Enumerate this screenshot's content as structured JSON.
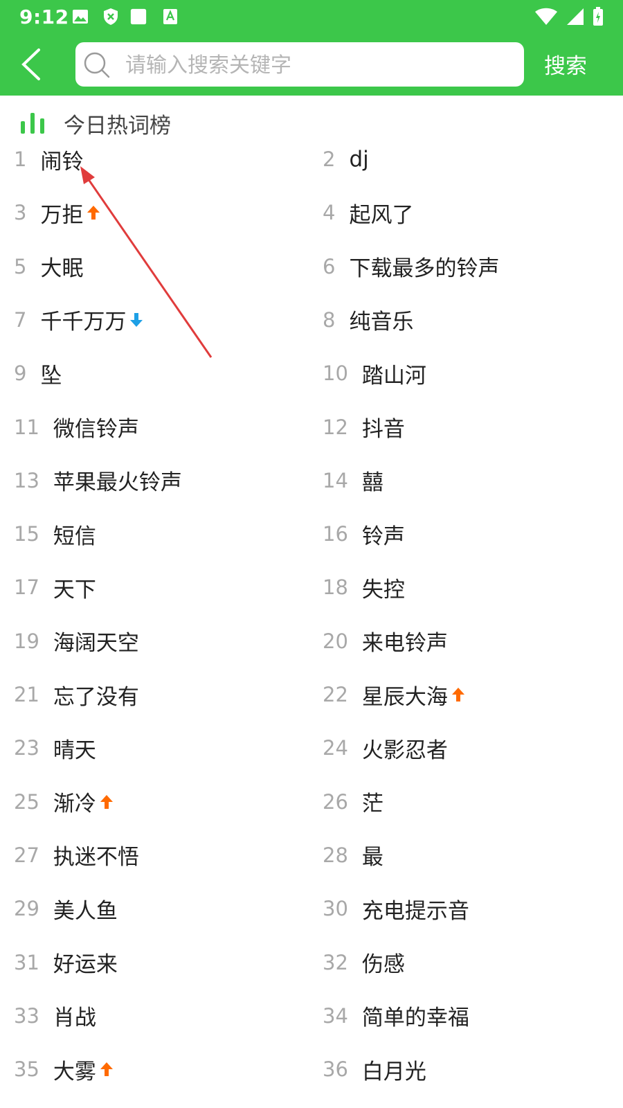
{
  "status_bar": {
    "time": "9:12"
  },
  "toolbar": {
    "search_placeholder": "请输入搜索关键字",
    "search_button": "搜索"
  },
  "section": {
    "title": "今日热词榜"
  },
  "colors": {
    "brand": "#3cc74a",
    "trend_up": "#ff6a00",
    "trend_down": "#1ea0e6"
  },
  "hot_words": [
    {
      "rank": "1",
      "word": "闹铃",
      "trend": ""
    },
    {
      "rank": "2",
      "word": "dj",
      "trend": ""
    },
    {
      "rank": "3",
      "word": "万拒",
      "trend": "up"
    },
    {
      "rank": "4",
      "word": "起风了",
      "trend": ""
    },
    {
      "rank": "5",
      "word": "大眠",
      "trend": ""
    },
    {
      "rank": "6",
      "word": "下载最多的铃声",
      "trend": ""
    },
    {
      "rank": "7",
      "word": "千千万万",
      "trend": "down"
    },
    {
      "rank": "8",
      "word": "纯音乐",
      "trend": ""
    },
    {
      "rank": "9",
      "word": "坠",
      "trend": ""
    },
    {
      "rank": "10",
      "word": "踏山河",
      "trend": ""
    },
    {
      "rank": "11",
      "word": "微信铃声",
      "trend": ""
    },
    {
      "rank": "12",
      "word": "抖音",
      "trend": ""
    },
    {
      "rank": "13",
      "word": "苹果最火铃声",
      "trend": ""
    },
    {
      "rank": "14",
      "word": "囍",
      "trend": ""
    },
    {
      "rank": "15",
      "word": "短信",
      "trend": ""
    },
    {
      "rank": "16",
      "word": "铃声",
      "trend": ""
    },
    {
      "rank": "17",
      "word": "天下",
      "trend": ""
    },
    {
      "rank": "18",
      "word": "失控",
      "trend": ""
    },
    {
      "rank": "19",
      "word": "海阔天空",
      "trend": ""
    },
    {
      "rank": "20",
      "word": "来电铃声",
      "trend": ""
    },
    {
      "rank": "21",
      "word": "忘了没有",
      "trend": ""
    },
    {
      "rank": "22",
      "word": "星辰大海",
      "trend": "up"
    },
    {
      "rank": "23",
      "word": "晴天",
      "trend": ""
    },
    {
      "rank": "24",
      "word": "火影忍者",
      "trend": ""
    },
    {
      "rank": "25",
      "word": "渐冷",
      "trend": "up"
    },
    {
      "rank": "26",
      "word": "茫",
      "trend": ""
    },
    {
      "rank": "27",
      "word": "执迷不悟",
      "trend": ""
    },
    {
      "rank": "28",
      "word": "最",
      "trend": ""
    },
    {
      "rank": "29",
      "word": "美人鱼",
      "trend": ""
    },
    {
      "rank": "30",
      "word": "充电提示音",
      "trend": ""
    },
    {
      "rank": "31",
      "word": "好运来",
      "trend": ""
    },
    {
      "rank": "32",
      "word": "伤感",
      "trend": ""
    },
    {
      "rank": "33",
      "word": "肖战",
      "trend": ""
    },
    {
      "rank": "34",
      "word": "简单的幸福",
      "trend": ""
    },
    {
      "rank": "35",
      "word": "大雾",
      "trend": "up"
    },
    {
      "rank": "36",
      "word": "白月光",
      "trend": ""
    }
  ]
}
